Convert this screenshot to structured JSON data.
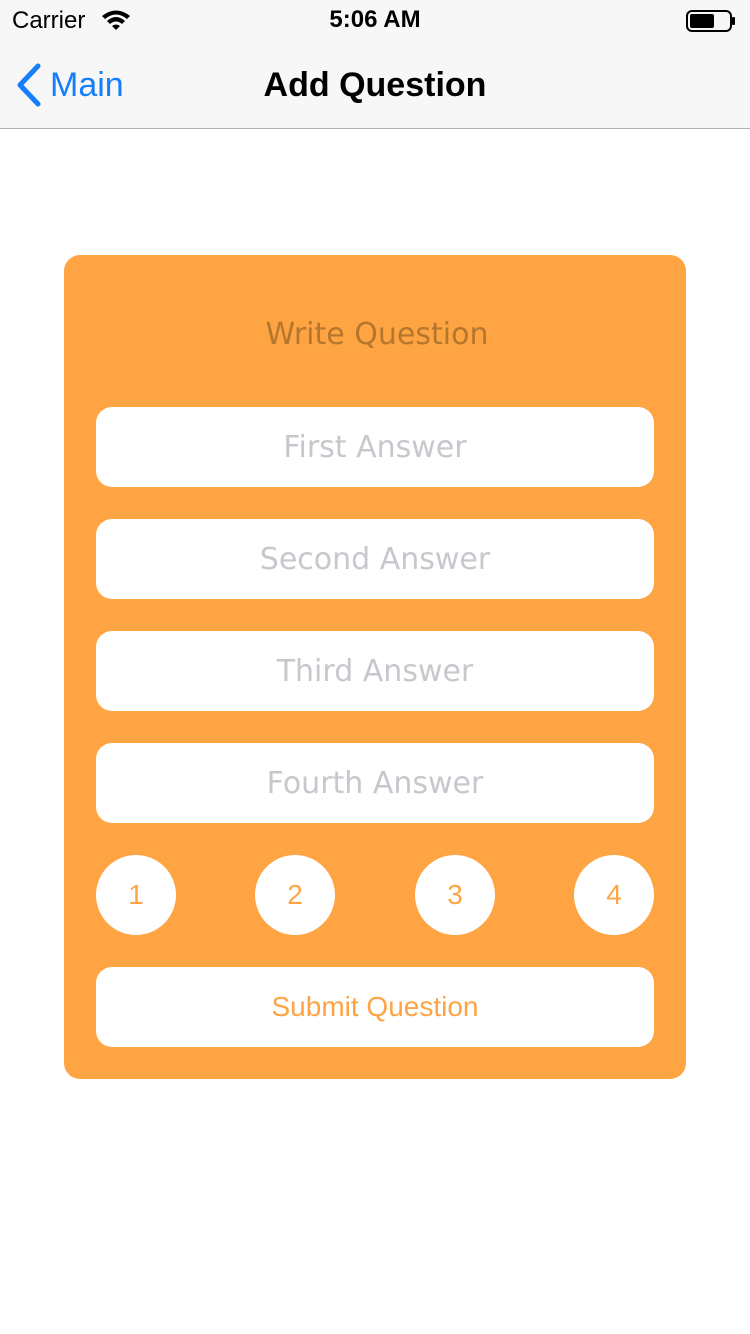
{
  "status_bar": {
    "carrier": "Carrier",
    "time": "5:06 AM"
  },
  "nav": {
    "back_label": "Main",
    "title": "Add Question"
  },
  "form": {
    "question_placeholder": "Write Question",
    "answers": [
      {
        "placeholder": "First Answer",
        "value": ""
      },
      {
        "placeholder": "Second Answer",
        "value": ""
      },
      {
        "placeholder": "Third Answer",
        "value": ""
      },
      {
        "placeholder": "Fourth Answer",
        "value": ""
      }
    ],
    "choices": [
      "1",
      "2",
      "3",
      "4"
    ],
    "submit_label": "Submit Question"
  },
  "colors": {
    "accent": "#fea443",
    "link": "#147efb",
    "nav_background": "#f7f7f7",
    "placeholder": "#c7c7cd"
  },
  "icons": {
    "signal": "wifi-icon",
    "battery": "battery-icon",
    "back": "chevron-left-icon"
  }
}
